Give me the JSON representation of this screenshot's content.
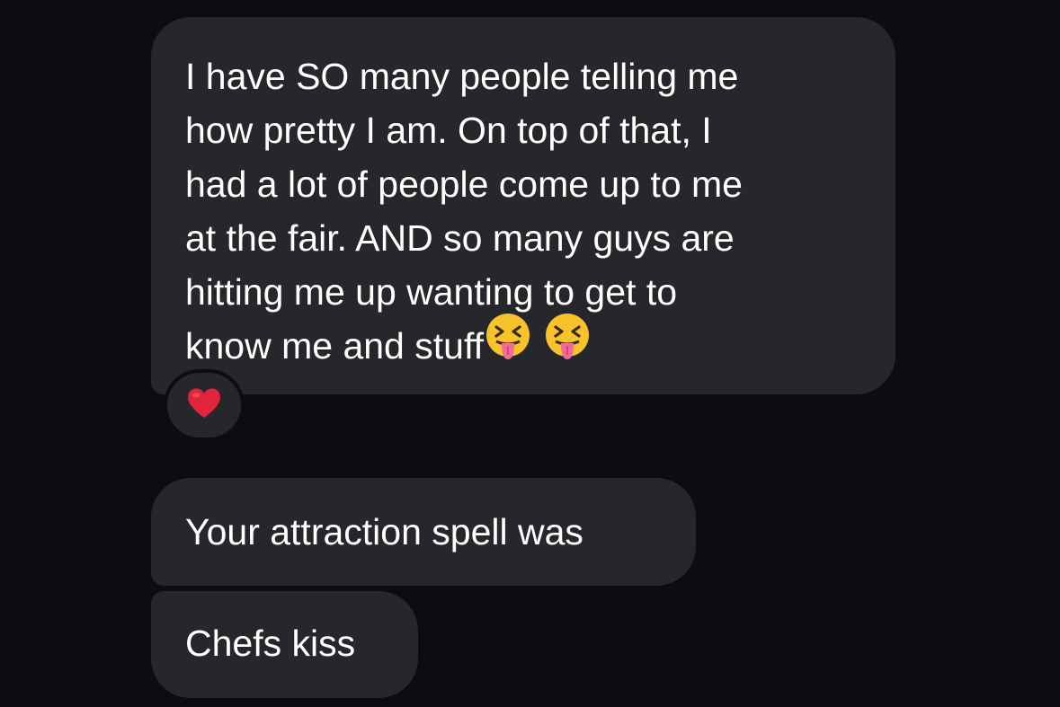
{
  "messages": [
    {
      "lines": [
        "I have SO many people telling me",
        "how pretty I am. On top of that, I",
        "had a lot of people come up to me",
        "at the fair. AND so many guys are",
        "hitting me up wanting to get to",
        "know me and stuff"
      ],
      "emojis": [
        "squinting-face-with-tongue-icon",
        "squinting-face-with-tongue-icon"
      ],
      "reaction": "heart-icon"
    },
    {
      "text": "Your attraction spell was"
    },
    {
      "text": "Chefs kiss"
    }
  ],
  "colors": {
    "background": "#0b0d10",
    "bubble": "#26272b",
    "text": "#ffffff",
    "heart": "#e0243a",
    "emoji_face": "#f7c22c",
    "emoji_tongue": "#f06a9a"
  }
}
